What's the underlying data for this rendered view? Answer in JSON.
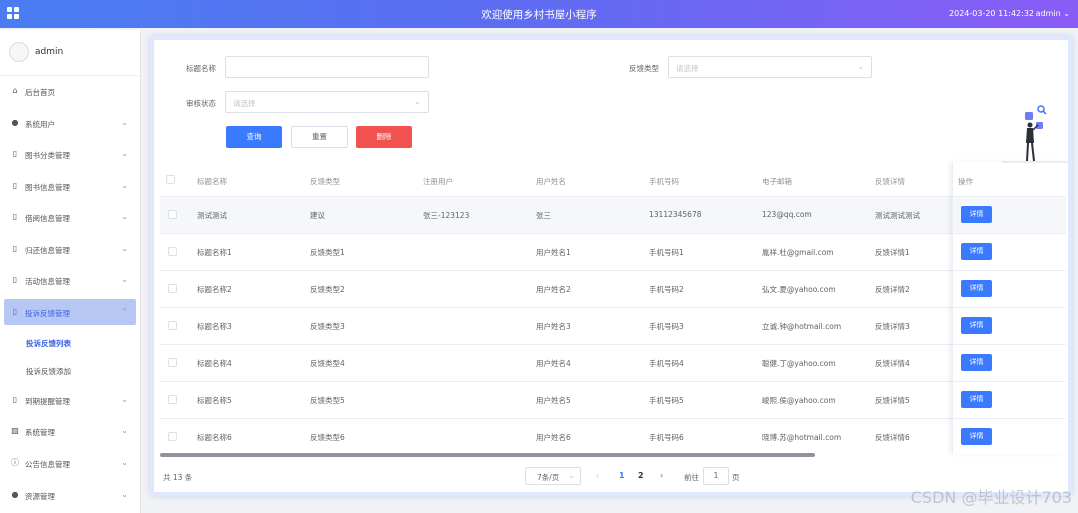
{
  "header": {
    "title": "欢迎使用乡村书屋小程序",
    "datetime": "2024-03-20 11:42:32",
    "user": "admin"
  },
  "sidebar": {
    "username": "admin",
    "items": [
      {
        "label": "后台首页",
        "icon": "home-icon",
        "arrow": false
      },
      {
        "label": "系统用户",
        "icon": "user-icon",
        "arrow": true
      },
      {
        "label": "图书分类管理",
        "icon": "doc-icon",
        "arrow": true
      },
      {
        "label": "图书信息管理",
        "icon": "doc-icon",
        "arrow": true
      },
      {
        "label": "借阅信息管理",
        "icon": "doc-icon",
        "arrow": true
      },
      {
        "label": "归还信息管理",
        "icon": "doc-icon",
        "arrow": true
      },
      {
        "label": "活动信息管理",
        "icon": "doc-icon",
        "arrow": true
      },
      {
        "label": "投诉反馈管理",
        "icon": "doc-icon",
        "arrow": true,
        "active": true
      },
      {
        "label": "到期提醒管理",
        "icon": "doc-icon",
        "arrow": true
      },
      {
        "label": "系统管理",
        "icon": "chart-icon",
        "arrow": true
      },
      {
        "label": "公告信息管理",
        "icon": "info-icon",
        "arrow": true
      },
      {
        "label": "资源管理",
        "icon": "pin-icon",
        "arrow": true
      }
    ],
    "subitems": [
      {
        "label": "投诉反馈列表",
        "active": true
      },
      {
        "label": "投诉反馈添加",
        "active": false
      }
    ]
  },
  "search": {
    "title_label": "标题名称",
    "type_label": "反馈类型",
    "type_placeholder": "请选择",
    "status_label": "审核状态",
    "status_placeholder": "请选择",
    "query_label": "查询",
    "reset_label": "重置",
    "delete_label": "删除"
  },
  "table": {
    "columns": [
      "标题名称",
      "反馈类型",
      "注册用户",
      "用户姓名",
      "手机号码",
      "电子邮箱",
      "反馈详情",
      "操作"
    ],
    "detail_label": "详情",
    "rows": [
      [
        "测试测试",
        "建议",
        "张三-123123",
        "张三",
        "13112345678",
        "123@qq.com",
        "测试测试测试"
      ],
      [
        "标题名称1",
        "反馈类型1",
        "",
        "用户姓名1",
        "手机号码1",
        "胤祥.杜@gmail.com",
        "反馈详情1"
      ],
      [
        "标题名称2",
        "反馈类型2",
        "",
        "用户姓名2",
        "手机号码2",
        "弘文.夏@yahoo.com",
        "反馈详情2"
      ],
      [
        "标题名称3",
        "反馈类型3",
        "",
        "用户姓名3",
        "手机号码3",
        "立诚.钟@hotmail.com",
        "反馈详情3"
      ],
      [
        "标题名称4",
        "反馈类型4",
        "",
        "用户姓名4",
        "手机号码4",
        "聪健.丁@yahoo.com",
        "反馈详情4"
      ],
      [
        "标题名称5",
        "反馈类型5",
        "",
        "用户姓名5",
        "手机号码5",
        "峻熙.侯@yahoo.com",
        "反馈详情5"
      ],
      [
        "标题名称6",
        "反馈类型6",
        "",
        "用户姓名6",
        "手机号码6",
        "晓博.苏@hotmail.com",
        "反馈详情6"
      ]
    ]
  },
  "pagination": {
    "total": "共 13 条",
    "page_size": "7条/页",
    "pages": [
      "1",
      "2"
    ],
    "current_page": "1",
    "goto_label": "前往",
    "goto_value": "1",
    "page_suffix": "页"
  },
  "watermark": "CSDN @毕业设计703",
  "colors": {
    "primary": "#3a7afe",
    "danger": "#f0524f",
    "header_gradient_start": "#4a7df3",
    "header_gradient_end": "#8a5cf6",
    "active_menu_bg": "#b7c7f4"
  }
}
